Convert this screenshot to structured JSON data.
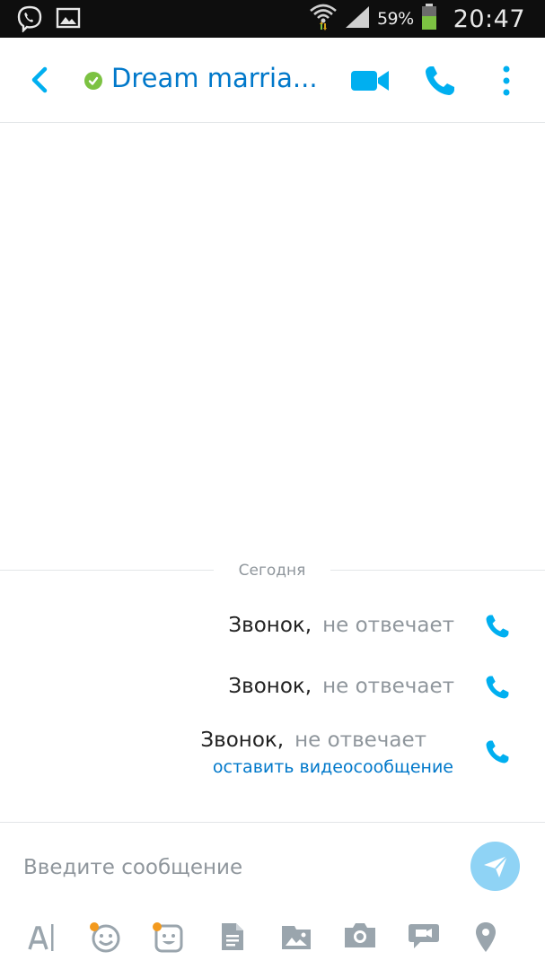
{
  "status_bar": {
    "battery_percent": "59%",
    "time": "20:47",
    "icons": [
      "viber-icon",
      "gallery-icon",
      "wifi-icon",
      "signal-icon",
      "battery-icon"
    ]
  },
  "header": {
    "title": "Dream marria...",
    "presence": "online",
    "accent_color": "#0078ca",
    "presence_color": "#7cc242"
  },
  "conversation": {
    "date_separator": "Сегодня",
    "calls": [
      {
        "label": "Звонок,",
        "status": "не отвечает",
        "link": ""
      },
      {
        "label": "Звонок,",
        "status": "не отвечает",
        "link": ""
      },
      {
        "label": "Звонок,",
        "status": "не отвечает",
        "link": "оставить видеосообщение"
      }
    ]
  },
  "composer": {
    "placeholder": "Введите сообщение",
    "value": "",
    "send_button_color": "#8fd3f5"
  },
  "toolbar": {
    "tools": [
      "text-format-icon",
      "emoticon-icon",
      "sticker-icon",
      "file-icon",
      "media-icon",
      "camera-icon",
      "video-message-icon",
      "location-icon"
    ],
    "notification_color": "#f39a1e"
  }
}
